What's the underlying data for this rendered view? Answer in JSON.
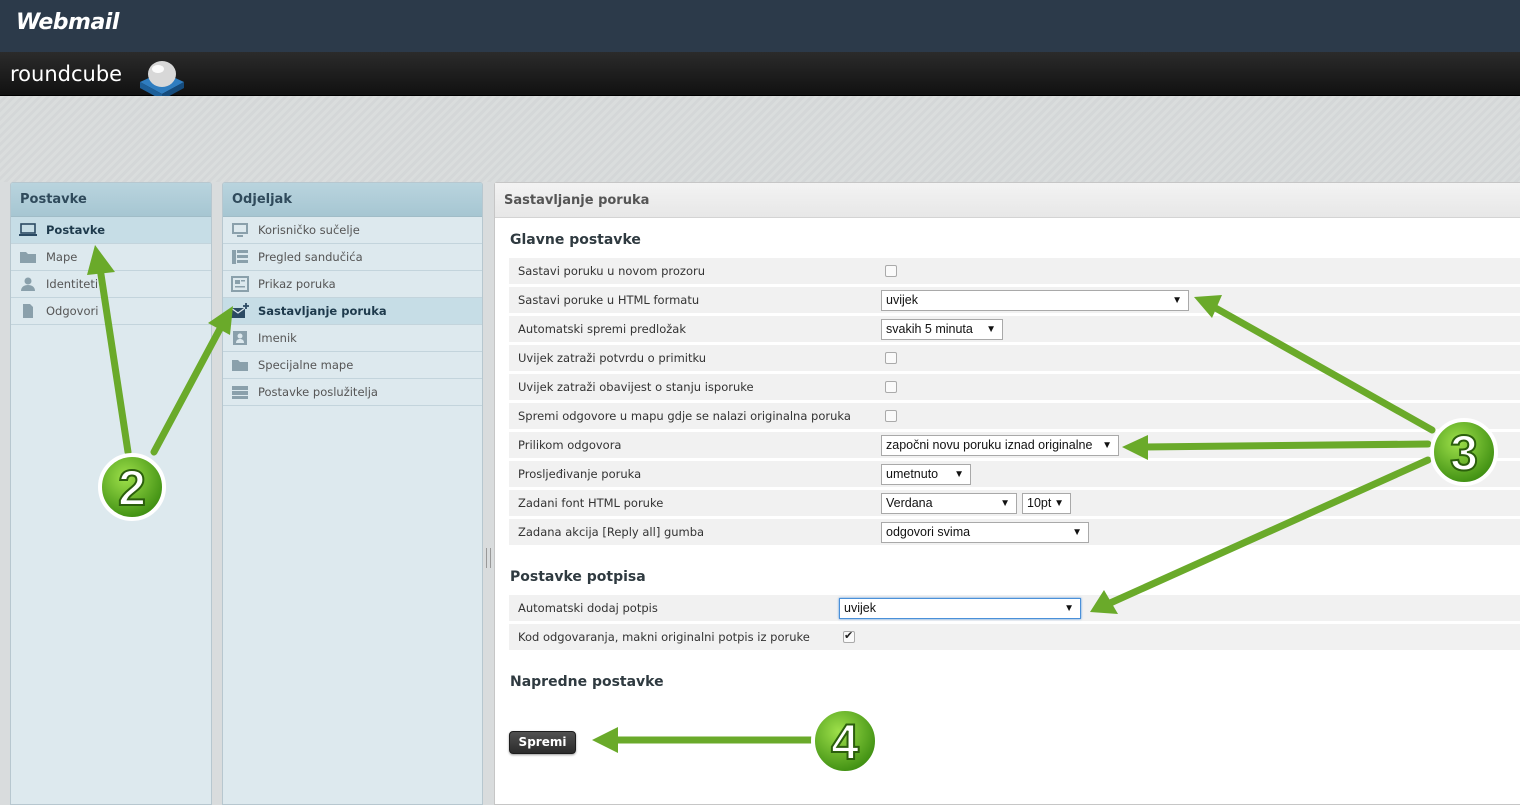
{
  "header": {
    "webmail_logo": "Webmail",
    "roundcube_logo": "roundcube"
  },
  "sidebar_left": {
    "title": "Postavke",
    "items": [
      {
        "label": "Postavke",
        "icon": "computer-icon",
        "selected": true
      },
      {
        "label": "Mape",
        "icon": "folder-icon",
        "selected": false
      },
      {
        "label": "Identiteti",
        "icon": "person-icon",
        "selected": false
      },
      {
        "label": "Odgovori",
        "icon": "document-icon",
        "selected": false
      }
    ]
  },
  "sidebar_mid": {
    "title": "Odjeljak",
    "items": [
      {
        "label": "Korisničko sučelje",
        "icon": "monitor-icon",
        "selected": false
      },
      {
        "label": "Pregled sandučića",
        "icon": "mailbox-view-icon",
        "selected": false
      },
      {
        "label": "Prikaz poruka",
        "icon": "message-view-icon",
        "selected": false
      },
      {
        "label": "Sastavljanje poruka",
        "icon": "compose-icon",
        "selected": true
      },
      {
        "label": "Imenik",
        "icon": "addressbook-icon",
        "selected": false
      },
      {
        "label": "Specijalne mape",
        "icon": "folder-icon",
        "selected": false
      },
      {
        "label": "Postavke poslužitelja",
        "icon": "server-icon",
        "selected": false
      }
    ]
  },
  "main": {
    "title": "Sastavljanje poruka",
    "section_main": {
      "title": "Glavne postavke",
      "rows": [
        {
          "label": "Sastavi poruku u novom prozoru",
          "type": "checkbox",
          "checked": false
        },
        {
          "label": "Sastavi poruke u HTML formatu",
          "type": "select",
          "value": "uvijek"
        },
        {
          "label": "Automatski spremi predložak",
          "type": "select",
          "value": "svakih 5 minuta"
        },
        {
          "label": "Uvijek zatraži potvrdu o primitku",
          "type": "checkbox",
          "checked": false
        },
        {
          "label": "Uvijek zatraži obavijest o stanju isporuke",
          "type": "checkbox",
          "checked": false
        },
        {
          "label": "Spremi odgovore u mapu gdje se nalazi originalna poruka",
          "type": "checkbox",
          "checked": false
        },
        {
          "label": "Prilikom odgovora",
          "type": "select",
          "value": "započni novu poruku iznad originalne"
        },
        {
          "label": "Prosljeđivanje poruka",
          "type": "select",
          "value": "umetnuto"
        },
        {
          "label": "Zadani font HTML poruke",
          "type": "select",
          "value": "Verdana",
          "value2": "10pt"
        },
        {
          "label": "Zadana akcija [Reply all] gumba",
          "type": "select",
          "value": "odgovori svima"
        }
      ]
    },
    "section_signature": {
      "title": "Postavke potpisa",
      "rows": [
        {
          "label": "Automatski dodaj potpis",
          "type": "select",
          "value": "uvijek"
        },
        {
          "label": "Kod odgovaranja, makni originalni potpis iz poruke",
          "type": "checkbox",
          "checked": true
        }
      ]
    },
    "section_advanced": {
      "title": "Napredne postavke"
    },
    "save_label": "Spremi"
  },
  "annotations": {
    "badge_2": "2",
    "badge_3": "3",
    "badge_4": "4",
    "arrow_color": "#6aaa2a"
  },
  "colors": {
    "topbar": "#2c3a4a",
    "panel_bg": "#dde9ee",
    "panel_header": "#a6c6d2"
  }
}
